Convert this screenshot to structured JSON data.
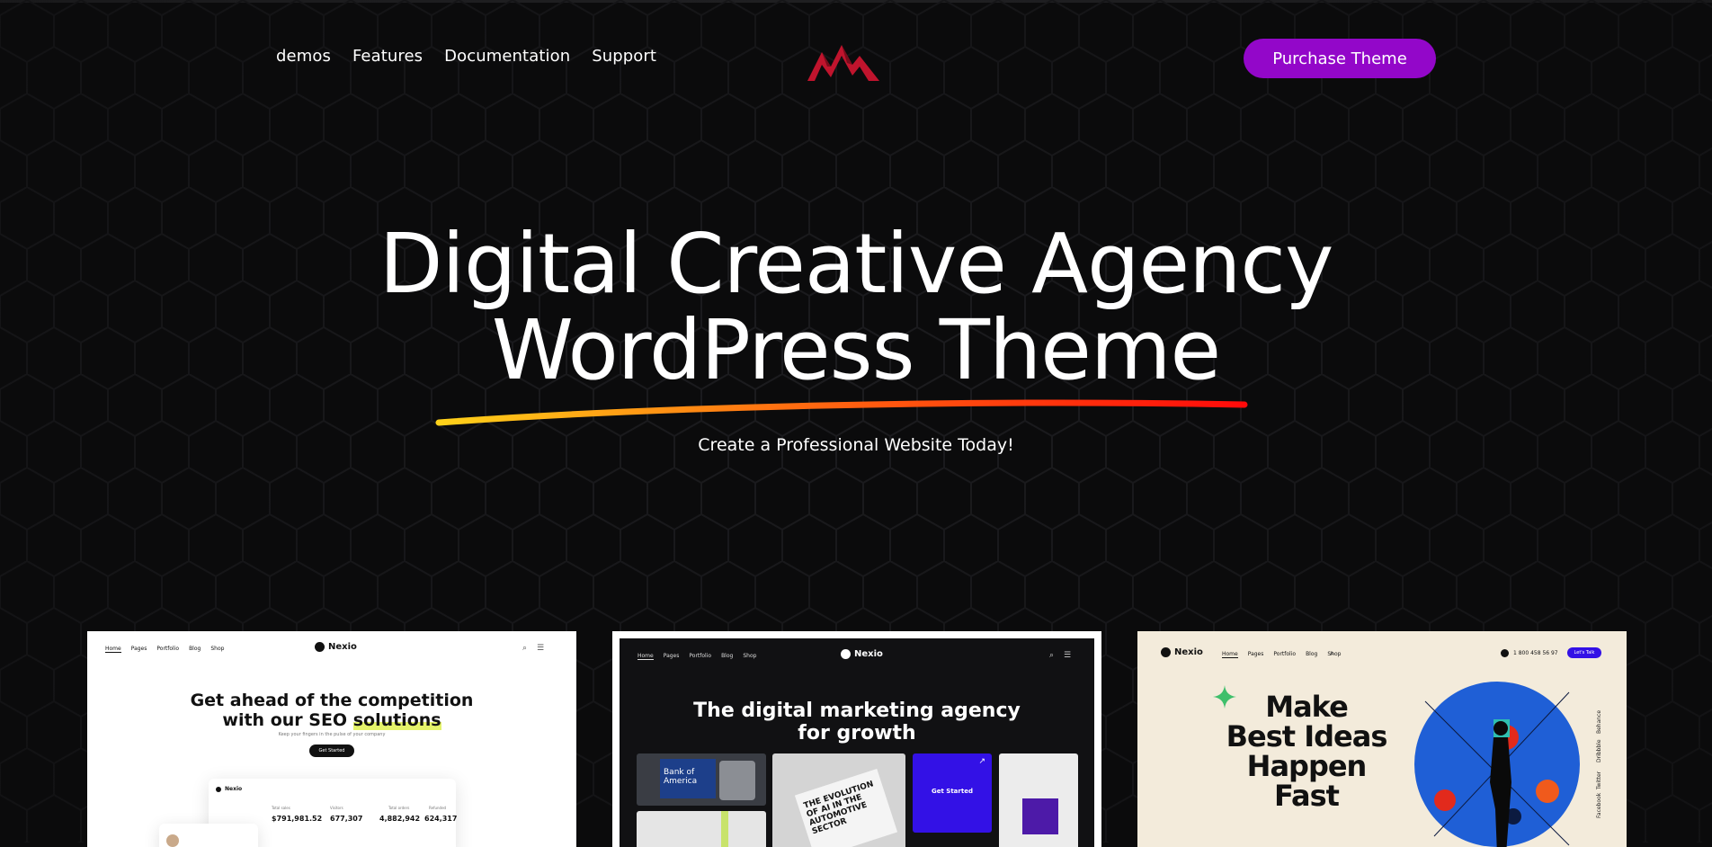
{
  "nav": {
    "items": [
      "demos",
      "Features",
      "Documentation",
      "Support"
    ],
    "cta_label": "Purchase Theme"
  },
  "hero": {
    "title_line1": "Digital Creative Agency",
    "title_line2": "WordPress Theme",
    "subtitle": "Create a Professional Website Today!"
  },
  "colors": {
    "background": "#0b0b0c",
    "cta": "#9307c9",
    "underline_start": "#ffd21a",
    "underline_end": "#ff0a0a",
    "logo": "#c0142d"
  },
  "demos": [
    {
      "brand": "Nexio",
      "menu": [
        "Home",
        "Pages",
        "Portfolio",
        "Blog",
        "Shop"
      ],
      "headline_line1": "Get ahead of the competition",
      "headline_line2_plain": "with our SEO ",
      "headline_line2_highlight": "solutions",
      "small_text": "Keep your fingers in the pulse of your company",
      "button": "Get Started",
      "stats": [
        "$791,981.52",
        "677,307",
        "4,882,942",
        "624,317"
      ],
      "stat_labels": [
        "Total sales",
        "Visitors",
        "Total orders",
        "Refunded"
      ]
    },
    {
      "brand": "Nexio",
      "menu": [
        "Home",
        "Pages",
        "Portfolio",
        "Blog",
        "Shop"
      ],
      "headline_line1": "The digital marketing agency",
      "headline_line2": "for growth",
      "tile_bank": "Bank of America",
      "tile_magazine": "THE EVOLUTION OF AI IN THE AUTOMOTIVE SECTOR",
      "tile_cta": "Get Started"
    },
    {
      "brand": "Nexio",
      "menu": [
        "Home",
        "Pages",
        "Portfolio",
        "Blog",
        "Shop"
      ],
      "phone": "1 800 458 56 97",
      "button": "Let's Talk",
      "headline_line1": "Make",
      "headline_line2": "Best Ideas",
      "headline_line3": "Happen",
      "headline_line4": "Fast",
      "social": [
        "Behance",
        "Dribbble",
        "Twitter",
        "Facebook"
      ]
    }
  ]
}
